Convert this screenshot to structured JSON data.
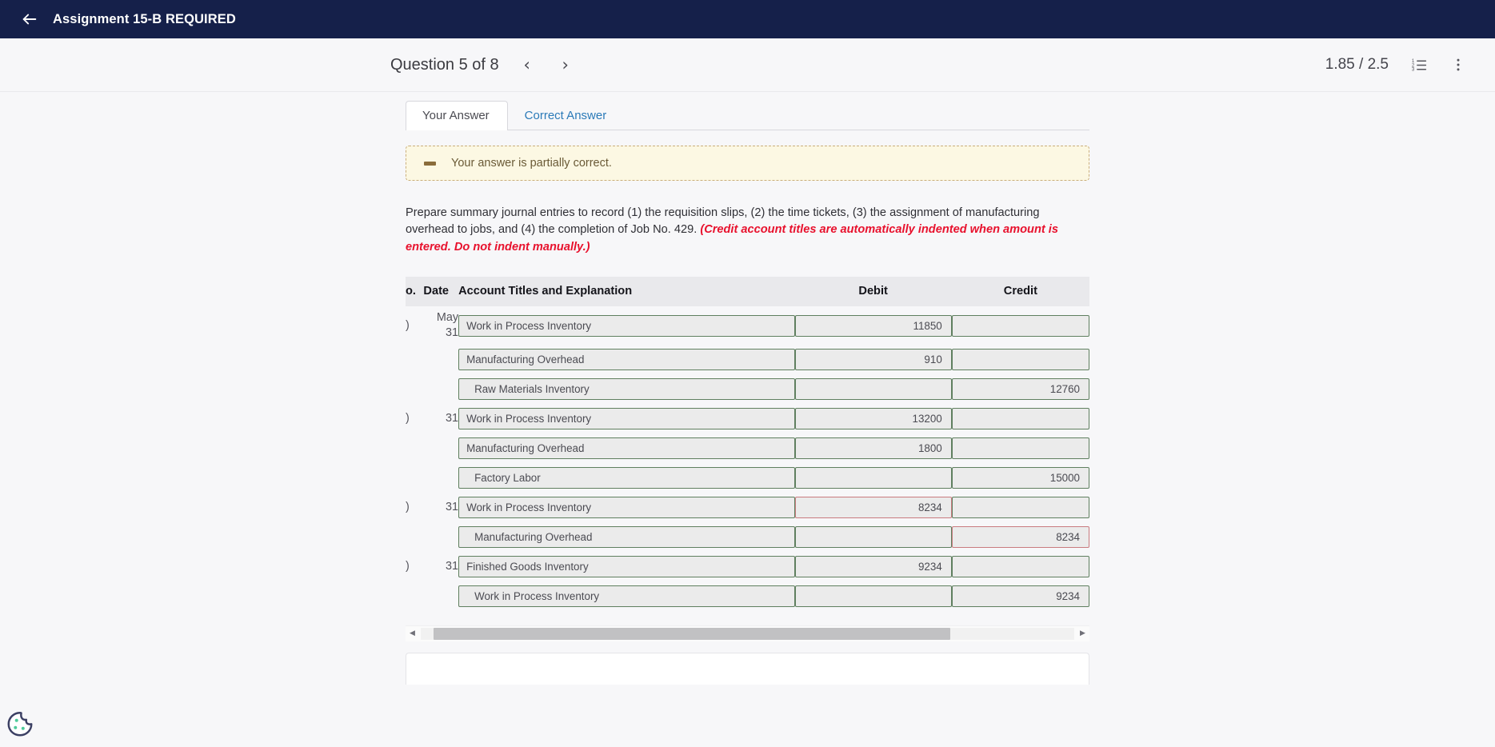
{
  "appbar": {
    "back_icon": "back-arrow-icon",
    "title": "Assignment 15-B REQUIRED"
  },
  "question_bar": {
    "title": "Question 5 of 8",
    "prev_icon": "‹",
    "next_icon": "›",
    "score": "1.85 / 2.5",
    "list_icon": "numbered-list-icon",
    "menu_icon": "more-vertical-icon"
  },
  "tabs": [
    {
      "label": "Your Answer",
      "active": true
    },
    {
      "label": "Correct Answer",
      "active": false
    }
  ],
  "alert": {
    "icon": "partial-dash-icon",
    "text": "Your answer is partially correct."
  },
  "prompt": {
    "main": "Prepare summary journal entries to record (1) the requisition slips, (2) the time tickets, (3) the assignment of manufacturing overhead to jobs, and (4) the completion of Job No. 429. ",
    "hint": "(Credit account titles are automatically indented when amount is entered. Do not indent manually.)"
  },
  "table": {
    "headers": {
      "no": "o.",
      "date": "Date",
      "account": "Account Titles and Explanation",
      "debit": "Debit",
      "credit": "Credit"
    },
    "rows": [
      {
        "no": ")",
        "date": "May\n31",
        "account": "Work in Process Inventory",
        "indent": false,
        "debit": "11850",
        "credit": "",
        "debit_bad": false,
        "credit_bad": false,
        "acct_bad": false
      },
      {
        "no": "",
        "date": "",
        "account": "Manufacturing Overhead",
        "indent": false,
        "debit": "910",
        "credit": "",
        "debit_bad": false,
        "credit_bad": false,
        "acct_bad": false
      },
      {
        "no": "",
        "date": "",
        "account": "Raw Materials Inventory",
        "indent": true,
        "debit": "",
        "credit": "12760",
        "debit_bad": false,
        "credit_bad": false,
        "acct_bad": false
      },
      {
        "no": ")",
        "date": "31",
        "account": "Work in Process Inventory",
        "indent": false,
        "debit": "13200",
        "credit": "",
        "debit_bad": false,
        "credit_bad": false,
        "acct_bad": false
      },
      {
        "no": "",
        "date": "",
        "account": "Manufacturing Overhead",
        "indent": false,
        "debit": "1800",
        "credit": "",
        "debit_bad": false,
        "credit_bad": false,
        "acct_bad": false
      },
      {
        "no": "",
        "date": "",
        "account": "Factory Labor",
        "indent": true,
        "debit": "",
        "credit": "15000",
        "debit_bad": false,
        "credit_bad": false,
        "acct_bad": false
      },
      {
        "no": ")",
        "date": "31",
        "account": "Work in Process Inventory",
        "indent": false,
        "debit": "8234",
        "credit": "",
        "debit_bad": true,
        "credit_bad": false,
        "acct_bad": false
      },
      {
        "no": "",
        "date": "",
        "account": "Manufacturing Overhead",
        "indent": true,
        "debit": "",
        "credit": "8234",
        "debit_bad": false,
        "credit_bad": true,
        "acct_bad": false
      },
      {
        "no": ")",
        "date": "31",
        "account": "Finished Goods Inventory",
        "indent": false,
        "debit": "9234",
        "credit": "",
        "debit_bad": false,
        "credit_bad": false,
        "acct_bad": false
      },
      {
        "no": "",
        "date": "",
        "account": "Work in Process Inventory",
        "indent": true,
        "debit": "",
        "credit": "9234",
        "debit_bad": false,
        "credit_bad": false,
        "acct_bad": false
      }
    ]
  },
  "scrollbar": {
    "left_arrow": "◀",
    "right_arrow": "▶",
    "thumb_position_percent": 2,
    "thumb_width_percent": 79
  },
  "cookie_widget": {
    "icon": "cookie-icon"
  },
  "colors": {
    "appbar_bg": "#15204a",
    "tab_link": "#2b7ab8",
    "alert_bg": "#fcf8e3",
    "alert_border": "#c9ae7a",
    "hint_red": "#e8112d",
    "field_ok_border": "#5f7f5f",
    "field_bad_border": "#c97b7f",
    "field_bg": "#ebebeb",
    "cookie_dot": "#4ecb9a"
  }
}
